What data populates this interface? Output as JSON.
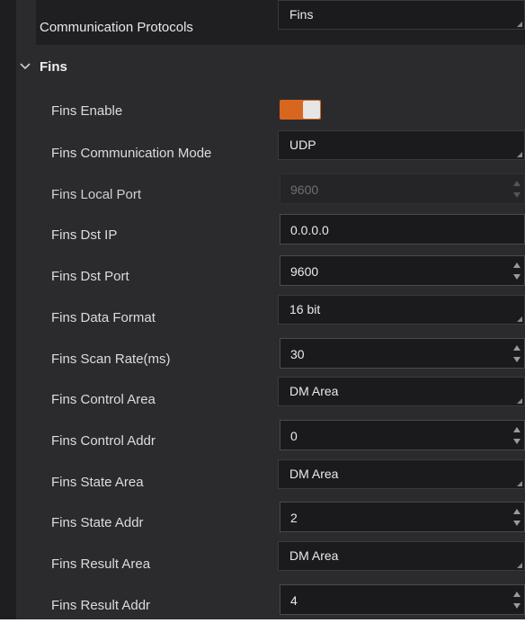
{
  "protocol": {
    "label": "Communication Protocols",
    "value": "Fins"
  },
  "group": {
    "title": "Fins",
    "chevron_icon": "chevron-down-icon"
  },
  "fins_enable": {
    "label": "Fins Enable",
    "enabled": true,
    "accent": "#d9661f"
  },
  "rows": [
    {
      "key": "comm_mode",
      "label": "Fins Communication Mode",
      "value": "UDP",
      "kind": "select",
      "disabled": false
    },
    {
      "key": "local_port",
      "label": "Fins Local Port",
      "value": "9600",
      "kind": "spin",
      "disabled": true
    },
    {
      "key": "dst_ip",
      "label": "Fins Dst IP",
      "value": "0.0.0.0",
      "kind": "text",
      "disabled": false
    },
    {
      "key": "dst_port",
      "label": "Fins Dst Port",
      "value": "9600",
      "kind": "spin",
      "disabled": false
    },
    {
      "key": "data_format",
      "label": "Fins Data Format",
      "value": "16 bit",
      "kind": "select",
      "disabled": false
    },
    {
      "key": "scan_rate",
      "label": "Fins Scan Rate(ms)",
      "value": "30",
      "kind": "spin",
      "disabled": false
    },
    {
      "key": "control_area",
      "label": "Fins Control Area",
      "value": "DM Area",
      "kind": "select",
      "disabled": false
    },
    {
      "key": "control_addr",
      "label": "Fins Control Addr",
      "value": "0",
      "kind": "spin",
      "disabled": false
    },
    {
      "key": "state_area",
      "label": "Fins State Area",
      "value": "DM Area",
      "kind": "select",
      "disabled": false
    },
    {
      "key": "state_addr",
      "label": "Fins State Addr",
      "value": "2",
      "kind": "spin",
      "disabled": false
    },
    {
      "key": "result_area",
      "label": "Fins Result Area",
      "value": "DM Area",
      "kind": "select",
      "disabled": false
    },
    {
      "key": "result_addr",
      "label": "Fins Result Addr",
      "value": "4",
      "kind": "spin",
      "disabled": false
    }
  ]
}
